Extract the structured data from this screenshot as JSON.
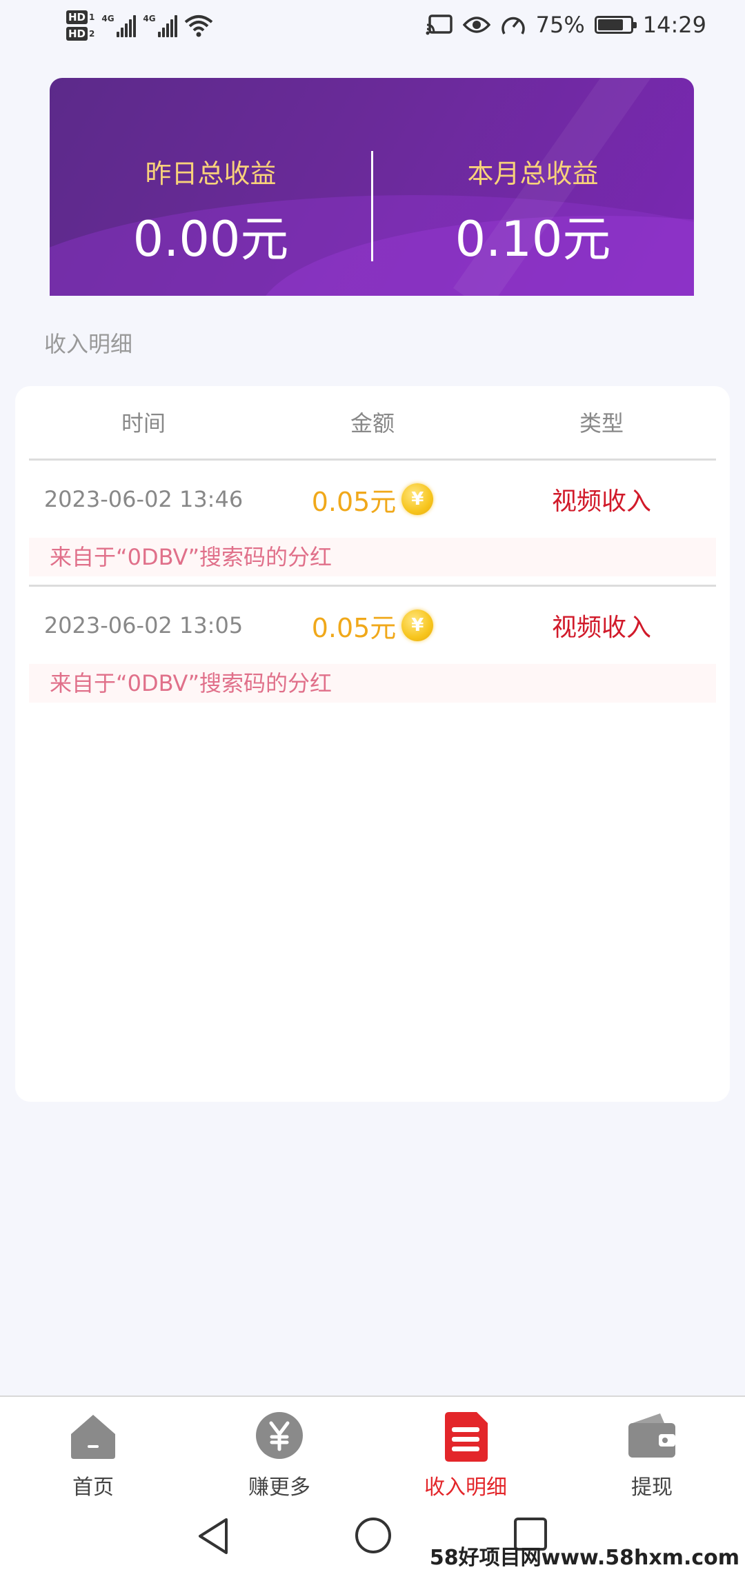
{
  "status_bar": {
    "hd1": "HD",
    "hd1_sub": "1",
    "hd2": "HD",
    "hd2_sub": "2",
    "sim1_label": "4G",
    "sim2_label": "4G",
    "battery_percent": "75%",
    "battery_level": 0.75,
    "time": "14:29",
    "icons": [
      "cast-icon",
      "eye-icon",
      "speed-meter-icon",
      "battery-icon",
      "wifi-icon"
    ]
  },
  "banner": {
    "yesterday_label": "昨日总收益",
    "yesterday_value": "0.00元",
    "month_label": "本月总收益",
    "month_value": "0.10元"
  },
  "section_title": "收入明细",
  "table": {
    "headers": [
      "时间",
      "金额",
      "类型"
    ],
    "rows": [
      {
        "time": "2023-06-02 13:46",
        "amount": "0.05元",
        "coin_symbol": "¥",
        "type": "视频收入",
        "note": "来自于“0DBV”搜索码的分红"
      },
      {
        "time": "2023-06-02 13:05",
        "amount": "0.05元",
        "coin_symbol": "¥",
        "type": "视频收入",
        "note": "来自于“0DBV”搜索码的分红"
      }
    ]
  },
  "tabs": [
    {
      "label": "首页",
      "icon": "home-icon",
      "active": false
    },
    {
      "label": "赚更多",
      "icon": "yuan-coin-icon",
      "active": false
    },
    {
      "label": "收入明细",
      "icon": "document-list-icon",
      "active": true
    },
    {
      "label": "提现",
      "icon": "wallet-icon",
      "active": false
    }
  ],
  "colors": {
    "accent_red": "#e3262a",
    "amount_gold": "#f0a81a",
    "banner_purple": "#6a2a99",
    "banner_label": "#f8d27a",
    "note_pink": "#e0708a"
  },
  "watermark": "58好项目网www.58hxm.com"
}
